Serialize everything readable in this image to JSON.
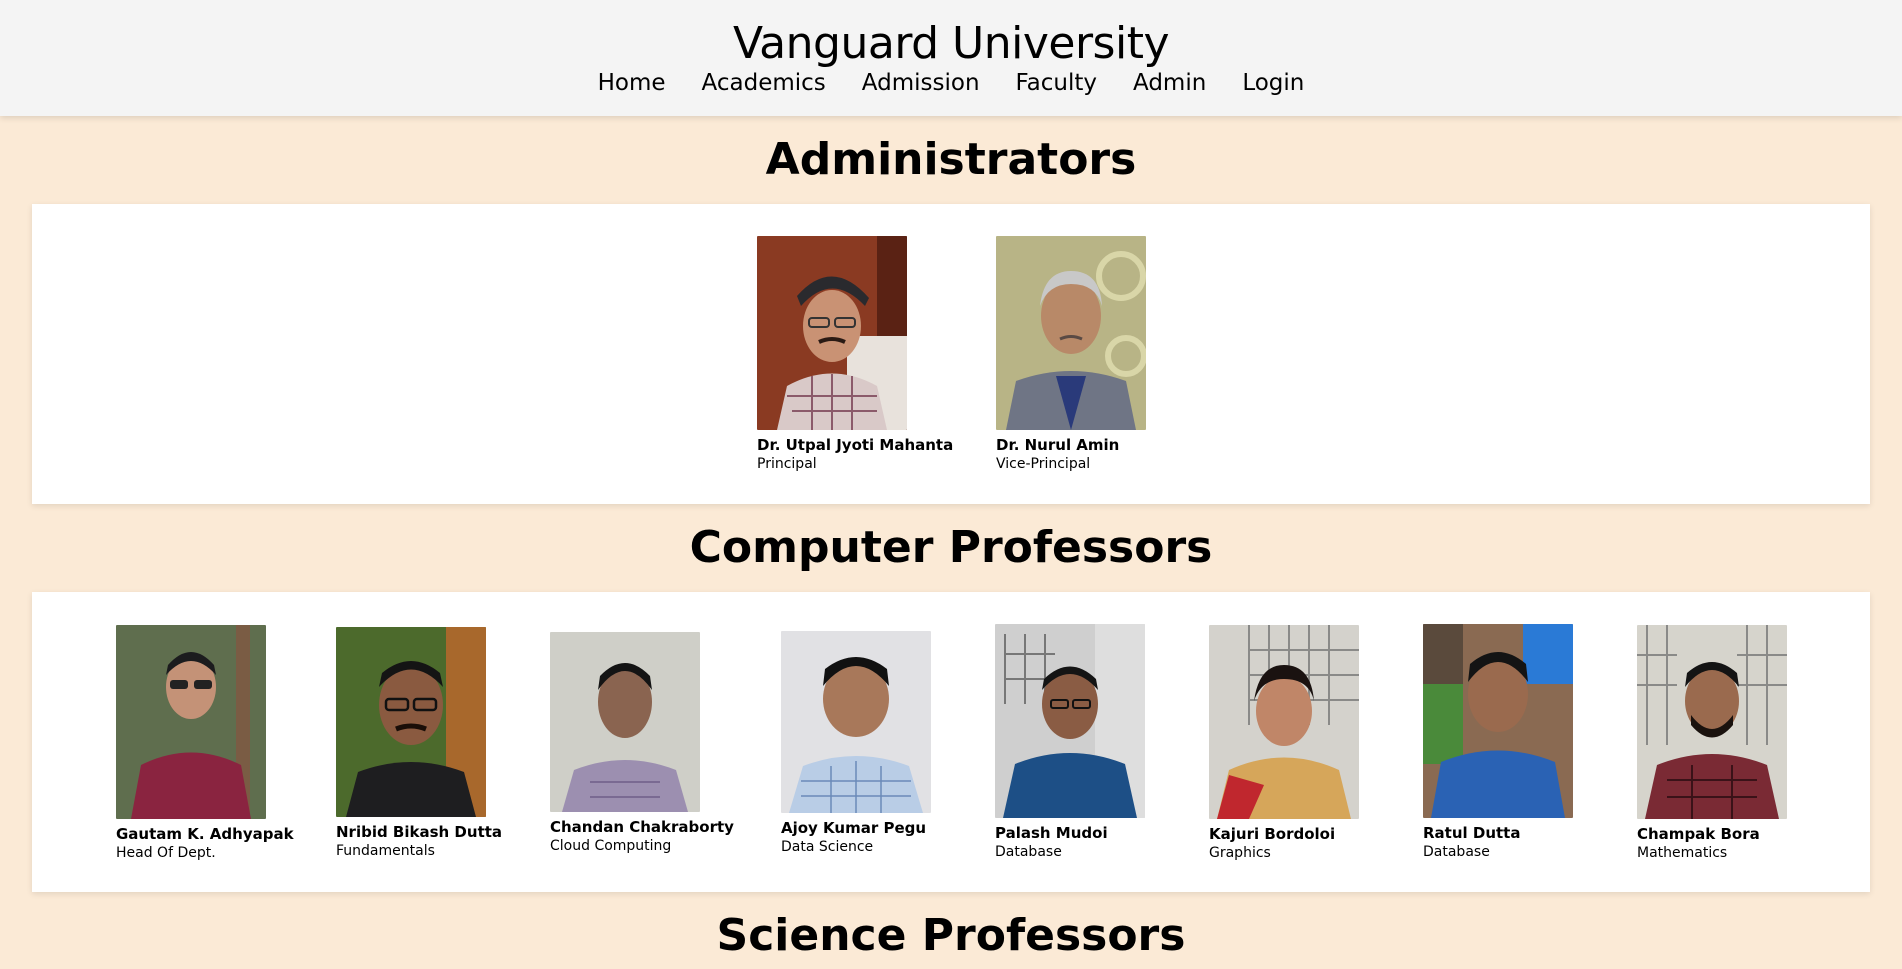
{
  "site": {
    "title": "Vanguard University"
  },
  "nav": [
    {
      "label": "Home"
    },
    {
      "label": "Academics"
    },
    {
      "label": "Admission"
    },
    {
      "label": "Faculty"
    },
    {
      "label": "Admin"
    },
    {
      "label": "Login"
    }
  ],
  "sections": {
    "administrators": {
      "title": "Administrators",
      "people": [
        {
          "name": "Dr. Utpal Jyoti Mahanta",
          "role": "Principal"
        },
        {
          "name": "Dr. Nurul Amin",
          "role": "Vice-Principal"
        }
      ]
    },
    "computer": {
      "title": "Computer Professors",
      "people": [
        {
          "name": "Gautam K. Adhyapak",
          "role": "Head Of Dept."
        },
        {
          "name": "Nribid Bikash Dutta",
          "role": "Fundamentals"
        },
        {
          "name": "Chandan Chakraborty",
          "role": "Cloud Computing"
        },
        {
          "name": "Ajoy Kumar Pegu",
          "role": "Data Science"
        },
        {
          "name": "Palash Mudoi",
          "role": "Database"
        },
        {
          "name": "Kajuri Bordoloi",
          "role": "Graphics"
        },
        {
          "name": "Ratul Dutta",
          "role": "Database"
        },
        {
          "name": "Champak Bora",
          "role": "Mathematics"
        }
      ]
    },
    "science": {
      "title": "Science Professors"
    }
  },
  "colors": {
    "page_bg": "#fbead6",
    "header_bg": "#f4f4f4",
    "panel_bg": "#ffffff"
  }
}
